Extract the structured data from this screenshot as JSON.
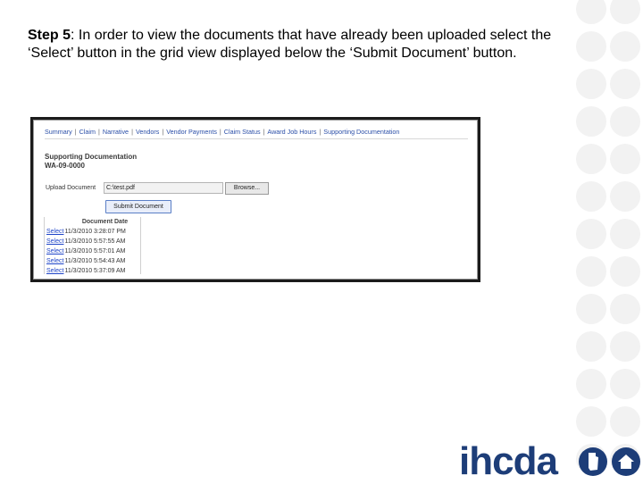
{
  "slide": {
    "step_label": "Step 5",
    "step_body": ": In order to view the documents that have already been uploaded select the ‘Select’ button in the grid view displayed below the ‘Submit Document’ button."
  },
  "screenshot": {
    "nav_items": [
      "Summary",
      "Claim",
      "Narrative",
      "Vendors",
      "Vendor Payments",
      "Claim Status",
      "Award Job Hours",
      "Supporting Documentation"
    ],
    "page_title": "Supporting Documentation",
    "page_subtitle": "WA-09-0000",
    "upload_label": "Upload Document",
    "upload_value": "C:\\test.pdf",
    "browse_label": "Browse...",
    "submit_label": "Submit Document",
    "grid": {
      "header": "Document Date",
      "select_label": "Select",
      "rows": [
        "11/3/2010 3:28:07 PM",
        "11/3/2010 5:57:55 AM",
        "11/3/2010 5:57:01 AM",
        "11/3/2010 5:54:43 AM",
        "11/3/2010 5:37:09 AM"
      ]
    }
  },
  "logo": {
    "text": "ihcda",
    "color": "#1d3d78"
  },
  "colors": {
    "accent": "#1d3d78",
    "link": "#2b4fa8"
  }
}
